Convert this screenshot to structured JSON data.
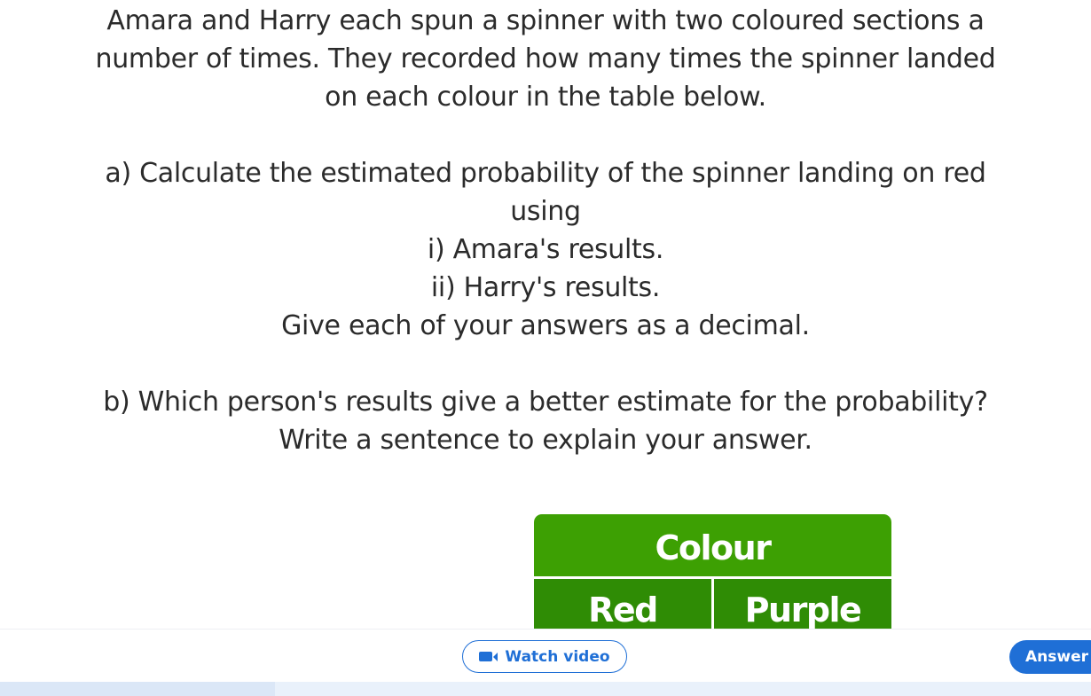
{
  "question": {
    "intro": [
      "Amara and Harry each spun a spinner with two coloured sections a",
      "number of times. They recorded how many times the spinner landed",
      "on each colour in the table below."
    ],
    "part_a": [
      "a) Calculate the estimated probability of the spinner landing on red",
      "using",
      "i) Amara's results.",
      "ii) Harry's results.",
      "Give each of your answers as a decimal."
    ],
    "part_b": [
      "b) Which person's results give a better estimate for the probability?",
      "Write a sentence to explain your answer."
    ]
  },
  "table": {
    "header": "Colour",
    "columns": [
      "Red",
      "Purple"
    ]
  },
  "footer": {
    "watch_video_label": "Watch video",
    "answer_label": "Answer",
    "watch_video_icon": "video-camera-icon"
  },
  "colors": {
    "table_header": "#3da003",
    "table_subheader": "#2f8c05",
    "accent_blue": "#1f6fd6"
  }
}
